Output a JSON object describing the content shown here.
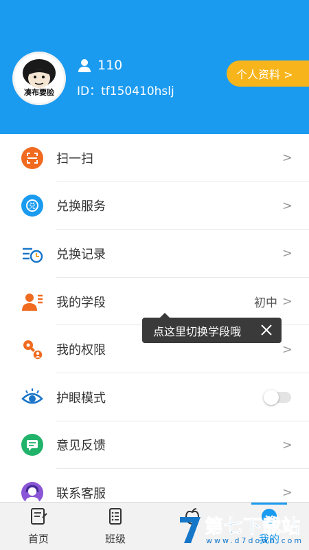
{
  "header": {
    "bg_color": "#1b9bf0",
    "avatar_caption": "凑布要脸",
    "username": "110",
    "id_text": "ID：tf150410hslj",
    "profile_button": "个人资料 >",
    "profile_button_color": "#f7b51b"
  },
  "menu": {
    "items": [
      {
        "label": "扫一扫",
        "icon": "scan-icon",
        "chevron": ">"
      },
      {
        "label": "兑换服务",
        "icon": "exchange-service-icon",
        "chevron": ">"
      },
      {
        "label": "兑换记录",
        "icon": "exchange-record-icon",
        "chevron": ">"
      },
      {
        "label": "我的学段",
        "icon": "study-stage-icon",
        "value": "初中",
        "chevron": ">"
      },
      {
        "label": "我的权限",
        "icon": "permission-key-icon",
        "chevron": ">"
      },
      {
        "label": "护眼模式",
        "icon": "eye-icon",
        "toggle_on": false
      },
      {
        "label": "意见反馈",
        "icon": "feedback-icon",
        "chevron": ">"
      },
      {
        "label": "联系客服",
        "icon": "customer-service-icon",
        "chevron": ">"
      }
    ]
  },
  "tooltip": {
    "text": "点这里切换学段哦"
  },
  "tabbar": {
    "tabs": [
      {
        "label": "首页",
        "icon": "home-notebook-icon"
      },
      {
        "label": "班级",
        "icon": "class-list-icon"
      },
      {
        "label": "",
        "icon": "apple-icon"
      },
      {
        "label": "我的",
        "icon": "profile-tab-icon",
        "active": true
      }
    ]
  },
  "watermark": {
    "main": "第七下载站",
    "sub": "www.d7down.com"
  }
}
